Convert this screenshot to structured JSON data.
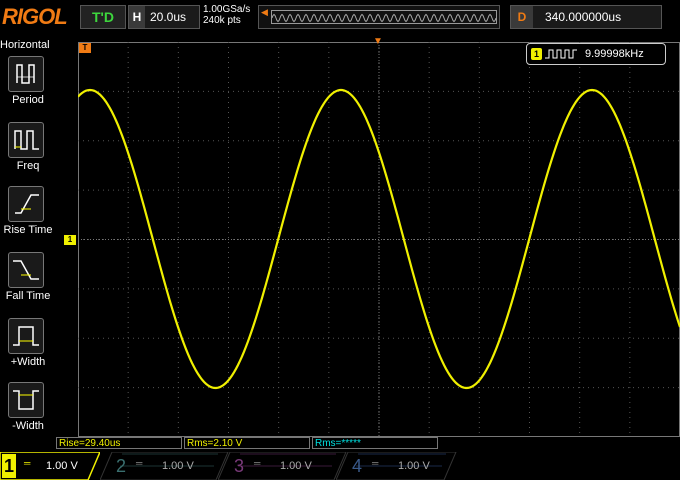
{
  "brand": "RIGOL",
  "top": {
    "trigger_state": "T'D",
    "timebase_label": "H",
    "timebase_value": "20.0us",
    "sample_rate": "1.00GSa/s",
    "memory_depth": "240k pts",
    "delay_label": "D",
    "delay_value": "340.000000us"
  },
  "left_menu": {
    "title": "Horizontal",
    "items": [
      {
        "label": "Period",
        "icon": "period-icon"
      },
      {
        "label": "Freq",
        "icon": "frequency-icon"
      },
      {
        "label": "Rise Time",
        "icon": "rise-time-icon"
      },
      {
        "label": "Fall Time",
        "icon": "fall-time-icon"
      },
      {
        "label": "+Width",
        "icon": "positive-width-icon"
      },
      {
        "label": "-Width",
        "icon": "negative-width-icon"
      }
    ]
  },
  "freq_counter": {
    "channel": "1",
    "value": "9.99998kHz"
  },
  "trigger_marker": "T",
  "channel1_marker": "1",
  "measurements": [
    {
      "text": "Rise=29.40us"
    },
    {
      "text": "Rms=2.10 V"
    },
    {
      "text": "Rms=*****"
    }
  ],
  "channels": [
    {
      "num": "1",
      "scale": "1.00 V",
      "active": true,
      "color": "#f0f000"
    },
    {
      "num": "2",
      "scale": "1.00 V",
      "active": false,
      "color": "#00e0e0"
    },
    {
      "num": "3",
      "scale": "1.00 V",
      "active": false,
      "color": "#e000e0"
    },
    {
      "num": "4",
      "scale": "1.00 V",
      "active": false,
      "color": "#3c7cff"
    }
  ],
  "colors": {
    "brand": "#f07b14",
    "trace": "#f0f000",
    "grid": "#555555"
  }
}
